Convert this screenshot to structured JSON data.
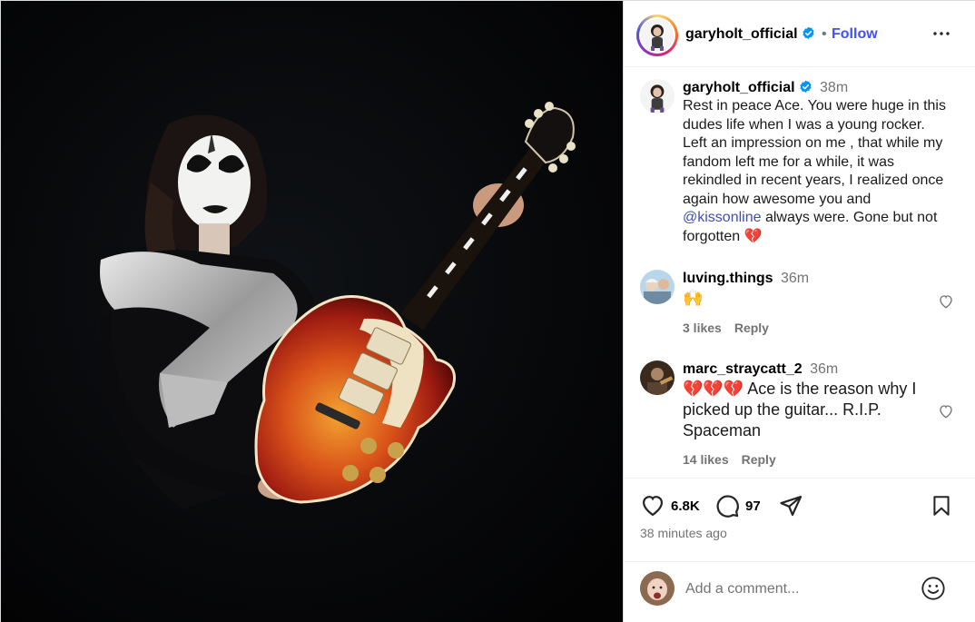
{
  "header": {
    "username": "garyholt_official",
    "follow_label": "Follow",
    "separator": "•"
  },
  "caption": {
    "username": "garyholt_official",
    "time": "38m",
    "text_part1": "Rest in peace Ace. You were huge in this dudes life when I was a young rocker. Left an impression on me , that while my fandom left me for a while, it was rekindled in recent years, I realized once again how awesome you and ",
    "mention": "@kissonline",
    "text_part2": " always were. Gone but not forgotten 💔"
  },
  "comments": [
    {
      "username": "luving.things",
      "time": "36m",
      "text": "🙌",
      "likes": "3 likes",
      "reply": "Reply"
    },
    {
      "username": "marc_straycatt_2",
      "time": "36m",
      "text": "💔💔💔 Ace is the reason why I picked up the guitar... R.I.P. Spaceman",
      "likes": "14 likes",
      "reply": "Reply"
    }
  ],
  "actions": {
    "like_count": "6.8K",
    "comment_count": "97",
    "posted_ago": "38 minutes ago"
  },
  "add_comment": {
    "placeholder": "Add a comment..."
  },
  "colors": {
    "verified": "#0095f6",
    "link": "#4150f7",
    "muted": "#737373",
    "border": "#dbdbdb"
  },
  "icons": [
    "verified-badge-icon",
    "more-options-icon",
    "heart-icon",
    "comment-icon",
    "share-icon",
    "bookmark-icon",
    "emoji-icon"
  ]
}
